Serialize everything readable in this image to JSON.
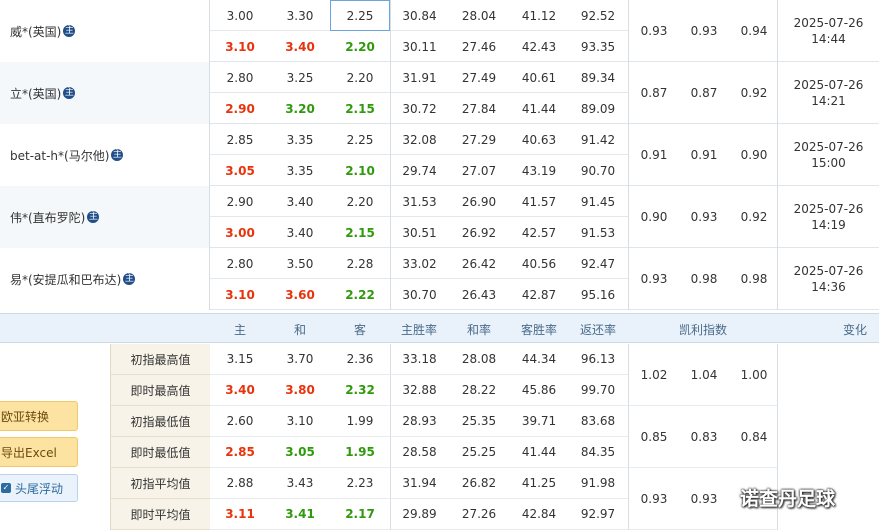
{
  "companies": [
    {
      "name": "威*(英国)",
      "host_icon": "主",
      "initial": {
        "home": "3.00",
        "draw": "3.30",
        "away": "2.25",
        "home_rate": "30.84",
        "draw_rate": "28.04",
        "away_rate": "41.12",
        "return_rate": "92.52"
      },
      "live": {
        "home": "3.10",
        "draw": "3.40",
        "away": "2.20",
        "home_rate": "30.11",
        "draw_rate": "27.46",
        "away_rate": "42.43",
        "return_rate": "93.35"
      },
      "kelly": [
        "0.93",
        "0.93",
        "0.94"
      ],
      "time_date": "2025-07-26",
      "time_clock": "14:44"
    },
    {
      "name": "立*(英国)",
      "host_icon": "主",
      "initial": {
        "home": "2.80",
        "draw": "3.25",
        "away": "2.20",
        "home_rate": "31.91",
        "draw_rate": "27.49",
        "away_rate": "40.61",
        "return_rate": "89.34"
      },
      "live": {
        "home": "2.90",
        "draw": "3.20",
        "away": "2.15",
        "home_rate": "30.72",
        "draw_rate": "27.84",
        "away_rate": "41.44",
        "return_rate": "89.09"
      },
      "kelly": [
        "0.87",
        "0.87",
        "0.92"
      ],
      "time_date": "2025-07-26",
      "time_clock": "14:21"
    },
    {
      "name": "bet-at-h*(马尔他)",
      "host_icon": "主",
      "initial": {
        "home": "2.85",
        "draw": "3.35",
        "away": "2.25",
        "home_rate": "32.08",
        "draw_rate": "27.29",
        "away_rate": "40.63",
        "return_rate": "91.42"
      },
      "live": {
        "home": "3.05",
        "draw": "3.35",
        "away": "2.10",
        "home_rate": "29.74",
        "draw_rate": "27.07",
        "away_rate": "43.19",
        "return_rate": "90.70"
      },
      "kelly": [
        "0.91",
        "0.91",
        "0.90"
      ],
      "time_date": "2025-07-26",
      "time_clock": "15:00"
    },
    {
      "name": "伟*(直布罗陀)",
      "host_icon": "主",
      "initial": {
        "home": "2.90",
        "draw": "3.40",
        "away": "2.20",
        "home_rate": "31.53",
        "draw_rate": "26.90",
        "away_rate": "41.57",
        "return_rate": "91.45"
      },
      "live": {
        "home": "3.00",
        "draw": "3.40",
        "away": "2.15",
        "home_rate": "30.51",
        "draw_rate": "26.92",
        "away_rate": "42.57",
        "return_rate": "91.53"
      },
      "kelly": [
        "0.90",
        "0.93",
        "0.92"
      ],
      "time_date": "2025-07-26",
      "time_clock": "14:19"
    },
    {
      "name": "易*(安提瓜和巴布达)",
      "host_icon": "主",
      "initial": {
        "home": "2.80",
        "draw": "3.50",
        "away": "2.28",
        "home_rate": "33.02",
        "draw_rate": "26.42",
        "away_rate": "40.56",
        "return_rate": "92.47"
      },
      "live": {
        "home": "3.10",
        "draw": "3.60",
        "away": "2.22",
        "home_rate": "30.70",
        "draw_rate": "26.43",
        "away_rate": "42.87",
        "return_rate": "95.16"
      },
      "kelly": [
        "0.93",
        "0.98",
        "0.98"
      ],
      "time_date": "2025-07-26",
      "time_clock": "14:36"
    }
  ],
  "summary_header": {
    "home": "主",
    "draw": "和",
    "away": "客",
    "home_rate": "主胜率",
    "draw_rate": "和率",
    "away_rate": "客胜率",
    "return_rate": "返还率",
    "kelly": "凯利指数",
    "change": "变化"
  },
  "summary_rows": [
    {
      "label": "初指最高值",
      "home": "3.15",
      "draw": "3.70",
      "away": "2.36",
      "home_rate": "33.18",
      "draw_rate": "28.08",
      "away_rate": "44.34",
      "return_rate": "96.13"
    },
    {
      "label": "即时最高值",
      "home": "3.40",
      "draw": "3.80",
      "away": "2.32",
      "home_rate": "32.88",
      "draw_rate": "28.22",
      "away_rate": "45.86",
      "return_rate": "99.70"
    },
    {
      "label": "初指最低值",
      "home": "2.60",
      "draw": "3.10",
      "away": "1.99",
      "home_rate": "28.93",
      "draw_rate": "25.35",
      "away_rate": "39.71",
      "return_rate": "83.68"
    },
    {
      "label": "即时最低值",
      "home": "2.85",
      "draw": "3.05",
      "away": "1.95",
      "home_rate": "28.58",
      "draw_rate": "25.25",
      "away_rate": "41.44",
      "return_rate": "84.35"
    },
    {
      "label": "初指平均值",
      "home": "2.88",
      "draw": "3.43",
      "away": "2.23",
      "home_rate": "31.94",
      "draw_rate": "26.82",
      "away_rate": "41.25",
      "return_rate": "91.98"
    },
    {
      "label": "即时平均值",
      "home": "3.11",
      "draw": "3.41",
      "away": "2.17",
      "home_rate": "29.89",
      "draw_rate": "27.26",
      "away_rate": "42.84",
      "return_rate": "92.97"
    }
  ],
  "summary_kelly": [
    [
      "1.02",
      "1.04",
      "1.00"
    ],
    [
      "0.85",
      "0.83",
      "0.84"
    ],
    [
      "0.93",
      "0.93",
      ""
    ]
  ],
  "buttons": {
    "euro_asia": "欧亚转换",
    "export_excel": "导出Excel",
    "float_label": "头尾浮动"
  },
  "watermark": "诺查丹足球",
  "colors": {
    "up": "#e8330d",
    "down": "#2e9a0c",
    "header_bg": "#e9f2fa",
    "row_alt": "#f5f8fb"
  }
}
